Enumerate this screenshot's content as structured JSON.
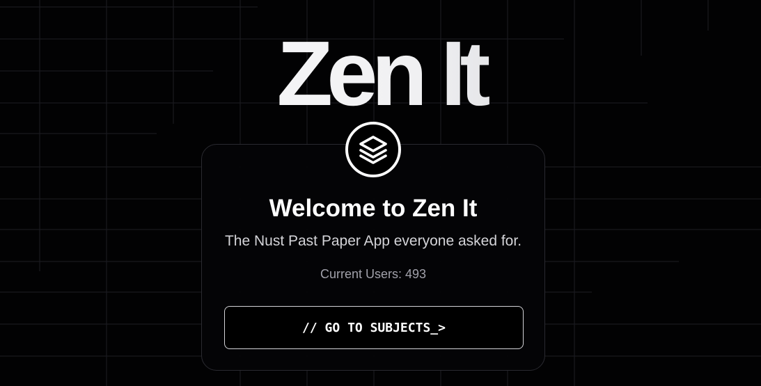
{
  "hero": {
    "logo_text": "Zen It"
  },
  "card": {
    "badge_icon": "layers-icon",
    "title": "Welcome to Zen It",
    "subtitle": "The Nust Past Paper App everyone asked for.",
    "users_text": "Current Users: 493",
    "cta_label": "// GO TO SUBJECTS_>"
  },
  "colors": {
    "background": "#020203",
    "grid_line": "#1c1c22",
    "card_border": "#2a2a30",
    "text_primary": "#ffffff",
    "text_muted": "#a1a1aa"
  }
}
